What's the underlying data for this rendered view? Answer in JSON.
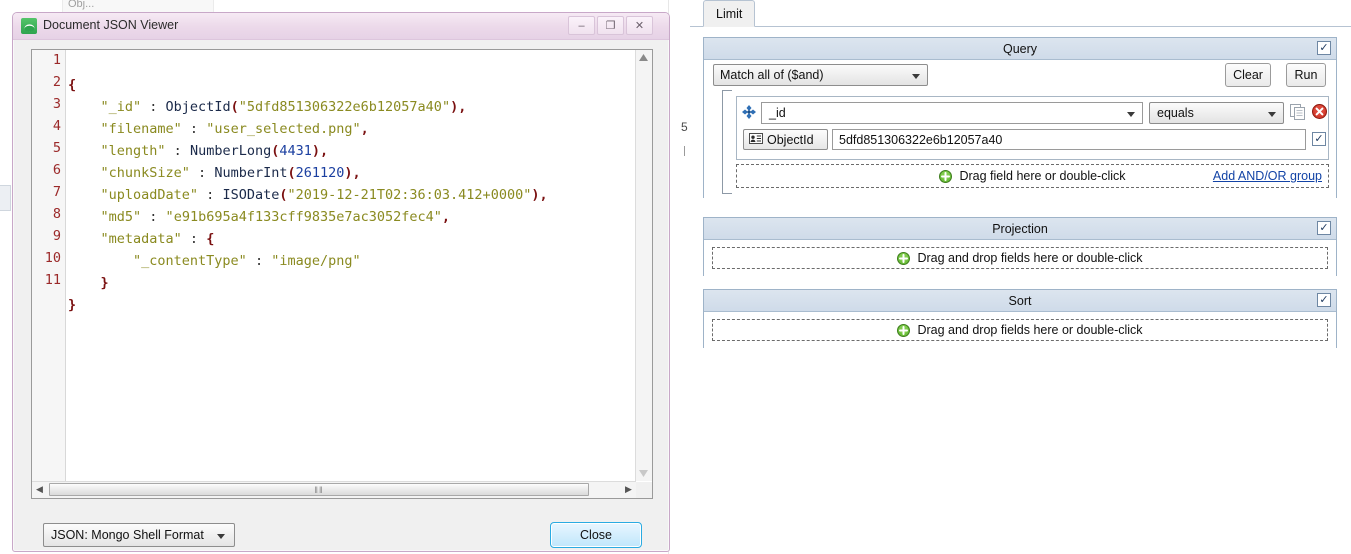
{
  "background": {
    "ghost_tab_label": "Obj...",
    "gutter_line_number": "5"
  },
  "right_pane": {
    "tabs": [
      {
        "label": "Limit"
      }
    ],
    "query": {
      "title": "Query",
      "enabled_checkbox": "✓",
      "match_select_value": "Match all of ($and)",
      "clear_label": "Clear",
      "run_label": "Run",
      "condition": {
        "field_value": "_id",
        "operator_value": "equals",
        "type_button_label": "ObjectId",
        "value": "5dfd851306322e6b12057a40",
        "value_checkbox": "✓"
      },
      "dropzone_label": "Drag field here or double-click",
      "add_group_link": "Add AND/OR group"
    },
    "projection": {
      "title": "Projection",
      "enabled_checkbox": "✓",
      "dropzone_label": "Drag and drop fields here or double-click"
    },
    "sort": {
      "title": "Sort",
      "enabled_checkbox": "✓",
      "dropzone_label": "Drag and drop fields here or double-click"
    }
  },
  "dialog": {
    "title": "Document JSON Viewer",
    "minimize_label": "–",
    "maximize_label": "❐",
    "close_label": "✕",
    "format_select_value": "JSON: Mongo Shell Format",
    "close_button_label": "Close",
    "hscroll_grip": "‖‖",
    "line_numbers": [
      "1",
      "2",
      "3",
      "4",
      "5",
      "6",
      "7",
      "8",
      "9",
      "10",
      "11"
    ],
    "document": {
      "_id": "5dfd851306322e6b12057a40",
      "filename": "user_selected.png",
      "length": "4431",
      "chunkSize": "261120",
      "uploadDate": "2019-12-21T02:36:03.412+0000",
      "md5": "e91b695a4f133cff9835e7ac3052fec4",
      "metadata": {
        "_contentType": "image/png"
      }
    },
    "code_lines": [
      "{",
      "    \"_id\" : ObjectId(\"5dfd851306322e6b12057a40\"),",
      "    \"filename\" : \"user_selected.png\",",
      "    \"length\" : NumberLong(4431),",
      "    \"chunkSize\" : NumberInt(261120),",
      "    \"uploadDate\" : ISODate(\"2019-12-21T02:36:03.412+0000\"),",
      "    \"md5\" : \"e91b695a4f133cff9835e7ac3052fec4\",",
      "    \"metadata\" : {",
      "        \"_contentType\" : \"image/png\"",
      "    }",
      "}"
    ]
  },
  "colors": {
    "accent_blue": "#2aabe2",
    "panel_header": "#cfdbe9",
    "title_bar": "#ecd9ea",
    "json_key": "#8a8a20",
    "json_number": "#1b3fa0",
    "json_brace": "#7a1010",
    "json_function": "#1b2a4a",
    "link": "#1243a6",
    "delete_red": "#cc2222",
    "plus_green": "#5aa82e"
  }
}
